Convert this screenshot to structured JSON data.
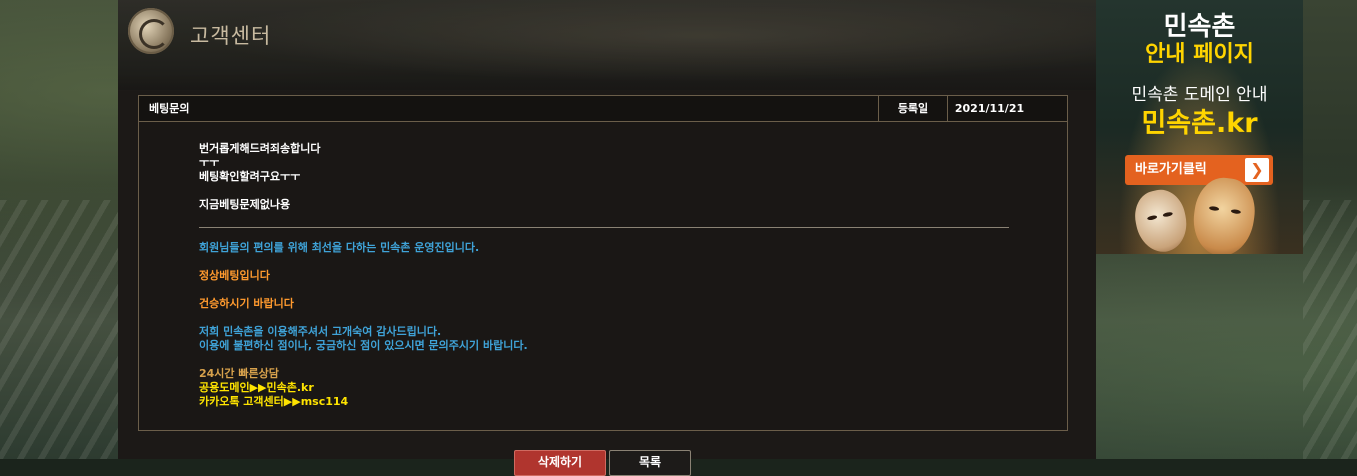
{
  "header": {
    "title": "고객센터"
  },
  "post": {
    "subject": "베팅문의",
    "date_label": "등록일",
    "date": "2021/11/21",
    "question_lines": [
      "번거롭게해드려죄송합니다",
      "ㅜㅜ",
      "베팅확인할려구요ㅜㅜ",
      "지금베팅문제없나용"
    ],
    "answer": {
      "greeting": "회원님들의 편의를 위해 최선을 다하는 민속촌 운영진입니다.",
      "status": "정상베팅입니다",
      "wish": "건승하시기 바랍니다",
      "thanks_1": "저희 민속촌을 이용해주셔서 고개숙여 감사드립니다.",
      "thanks_2": "이용에 불편하신 점이나, 궁금하신 점이 있으시면 문의주시기 바랍니다.",
      "support_title": "24시간 빠른상담",
      "domain_info": "공용도메인▶▶민속촌.kr",
      "kakao_info": "카카오톡 고객센터▶▶msc114"
    }
  },
  "buttons": {
    "delete": "삭제하기",
    "list": "목록"
  },
  "ad": {
    "title_1": "민속촌",
    "title_2": "안내 페이지",
    "line_1": "민속촌 도메인 안내",
    "line_2": "민속촌.kr",
    "button": "바로가기클릭",
    "button_icon": "chevron-right-icon",
    "colors": {
      "accent_yellow": "#ffd400",
      "button_orange": "#e4621f"
    }
  },
  "colors": {
    "answer_blue": "#3fa3d8",
    "answer_orange": "#ff9a2e",
    "support_tan": "#d8a24c",
    "support_yellow": "#ffe400",
    "delete_button_red": "#b0352e"
  }
}
